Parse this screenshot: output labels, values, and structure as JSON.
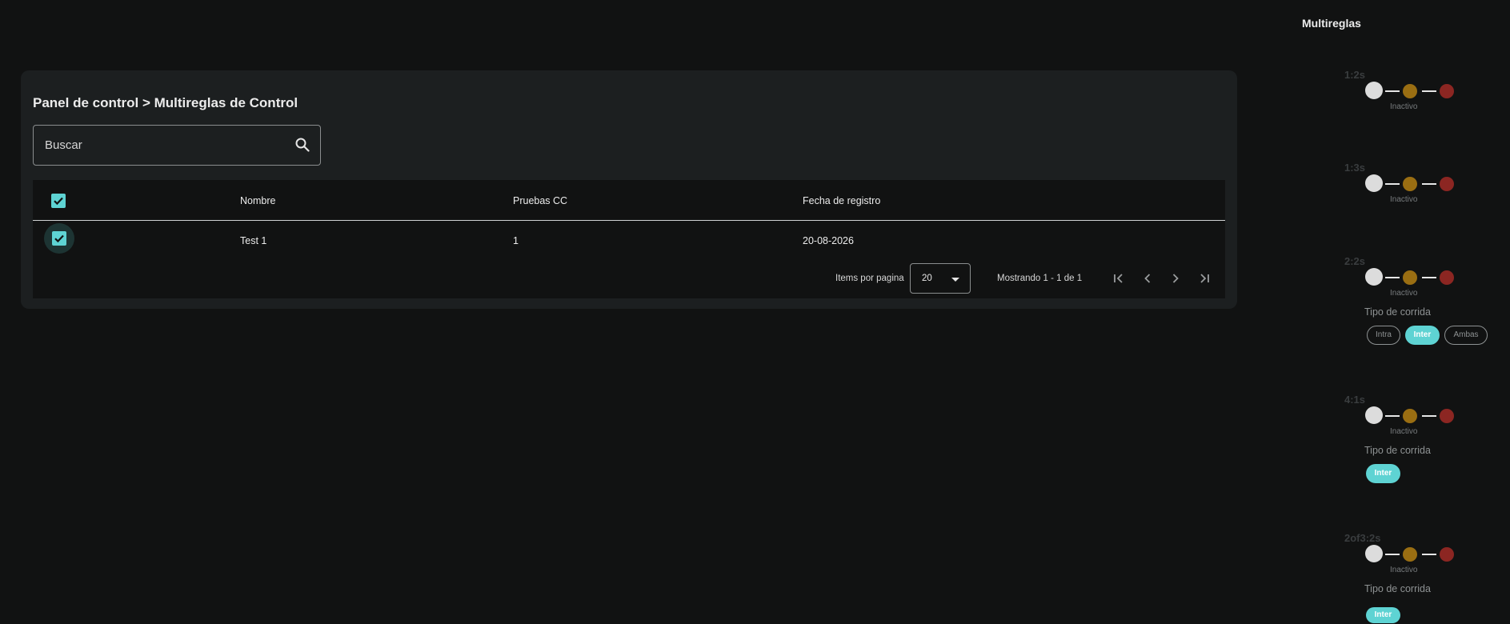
{
  "main": {
    "breadcrumb": "Panel de control > Multireglas de Control",
    "search": {
      "placeholder": "Buscar",
      "value": ""
    },
    "table": {
      "headers": [
        "Nombre",
        "Pruebas CC",
        "Fecha de registro"
      ],
      "rows": [
        {
          "nombre": "Test 1",
          "pruebas": "1",
          "fecha": "20-08-2026",
          "checked": true
        }
      ],
      "select_all_checked": true
    },
    "paginator": {
      "items_label": "Items por pagina",
      "page_size": "20",
      "range_label": "Mostrando 1 - 1 de 1"
    }
  },
  "sidebar": {
    "title": "Multireglas",
    "lights_colors": [
      "#dcdcdc",
      "#9a6e12",
      "#8c2622"
    ],
    "accent": "#5ed3d3",
    "rules": [
      {
        "name": "1:2s",
        "status": "Inactivo",
        "tipo_label": "",
        "chips": []
      },
      {
        "name": "1:3s",
        "status": "Inactivo",
        "tipo_label": "",
        "chips": []
      },
      {
        "name": "2:2s",
        "status": "Inactivo",
        "tipo_label": "Tipo de corrida",
        "chips": [
          {
            "label": "Intra",
            "active": false
          },
          {
            "label": "Inter",
            "active": true
          },
          {
            "label": "Ambas",
            "active": false
          }
        ]
      },
      {
        "name": "4:1s",
        "status": "Inactivo",
        "tipo_label": "Tipo de corrida",
        "chips": [
          {
            "label": "Inter",
            "active": true
          }
        ]
      },
      {
        "name": "2of3:2s",
        "status": "Inactivo",
        "tipo_label": "Tipo de corrida",
        "chips": [
          {
            "label": "Inter",
            "active": true
          }
        ]
      }
    ]
  }
}
